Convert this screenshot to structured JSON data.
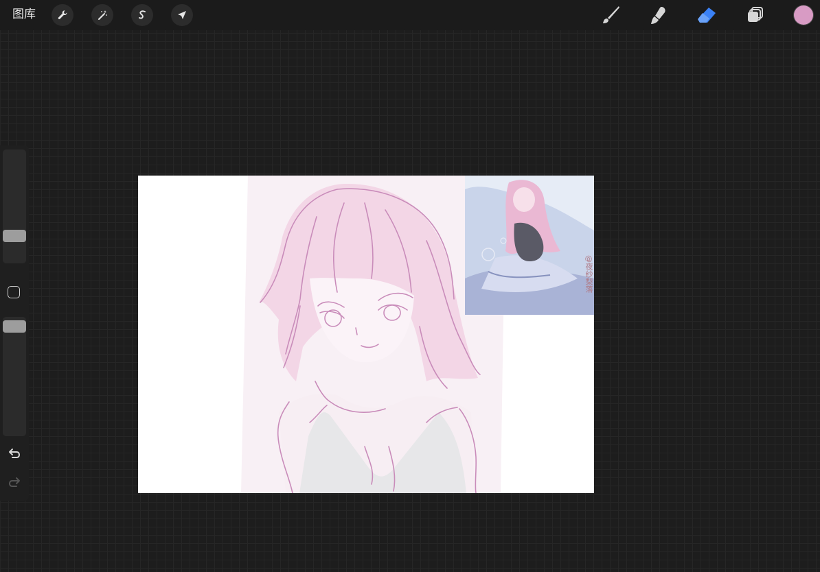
{
  "toolbar": {
    "gallery_label": "图库",
    "left_tools": [
      "wrench-icon",
      "magic-wand-icon",
      "selection-icon",
      "transform-arrow-icon"
    ],
    "right_tools": [
      "brush-icon",
      "smudge-icon",
      "eraser-icon",
      "layers-icon"
    ],
    "active_tool": "eraser-icon"
  },
  "colors": {
    "current_color": "#d89bc4",
    "active_tool_accent": "#3b82f6",
    "line_art": "#c98cba"
  },
  "reference": {
    "watermark_text": "@夜纱梨落"
  }
}
